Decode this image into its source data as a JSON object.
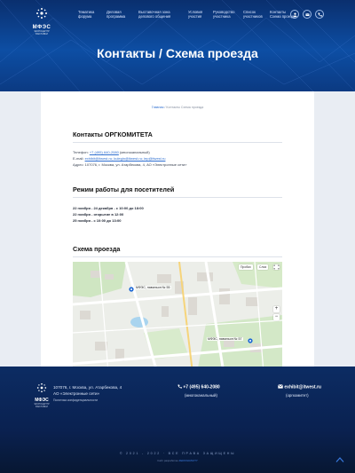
{
  "header": {
    "logo": {
      "name": "МФЭС",
      "sub": "ЭКСПОЦЕНТР ВЫСТАВКИ"
    },
    "nav": [
      "Тематика форума",
      "Деловая программа",
      "Выставочная зона делового общения",
      "Условия участия",
      "Руководство участника",
      "Список участников",
      "Контакты Схема проезда"
    ],
    "buttons": [
      "user-icon",
      "mail-icon",
      "phone-icon"
    ],
    "title": "Контакты / Схема проезда"
  },
  "breadcrumb": {
    "home": "Главная",
    "sep": " / ",
    "current": "Контакты Схема проезда"
  },
  "contacts": {
    "title": "Контакты ОРГКОМИТЕТА",
    "phone_label": "Телефон: ",
    "phone": "+7 (495) 640-2080",
    "phone_note": " (многоканальный)",
    "email_label": "E-mail: ",
    "emails": "exhibit@itwest.ru; kulegin@itwest.ru; iep@itwest.ru",
    "address": "Адрес: 107076, г. Москва, ул. Атарбекова, 4, АО «Электронные сети»"
  },
  "schedule": {
    "title": "Режим работы для посетителей",
    "rows": [
      {
        "date": "22 ноября - 24 декабря",
        "text": " - с 10:00 до 18:00"
      },
      {
        "date": "22 ноября",
        "text": " - открытие в 12:00"
      },
      {
        "date": "25 ноября",
        "text": " - с 10:00 до 13:00"
      }
    ]
  },
  "map": {
    "title": "Схема проезда",
    "controls": {
      "traffic": "Пробки",
      "layers": "Слои"
    },
    "pins": [
      "МФЭС, павильон № 55",
      "МФЭС, павильон № 57"
    ],
    "open_link": "Открыть в Яндекс.Картах",
    "copyright": "© Яндекс  Условия  200 м"
  },
  "footer": {
    "address": "107076, г. Москва, ул. Атарбекова, 4",
    "company": "АО «Электронные сети»",
    "privacy": "Политика конфиденциальности",
    "phone": "+7 (495) 640-2080",
    "phone_note": "(многоканальный)",
    "email": "exhibit@itwest.ru",
    "email_note": "(оргкомитет)",
    "copyright": "© 2021 - 2022 · ВСЕ ПРАВА ЗАЩИЩЕНЫ",
    "dev_label": "Сайт разработан ",
    "dev_name": "ZEROGRAVITY"
  },
  "colors": {
    "brand": "#0d4ea4",
    "accent": "#2f6fd0",
    "footer": "#0a2150"
  }
}
